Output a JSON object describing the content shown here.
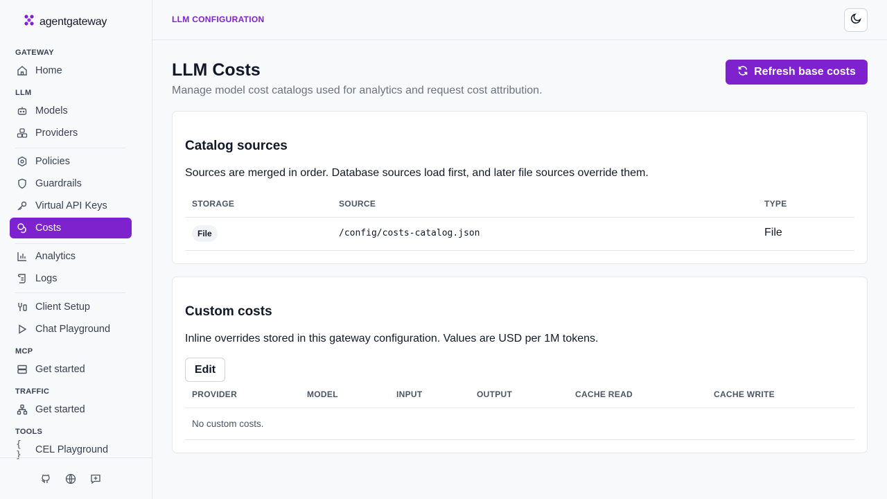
{
  "app": {
    "brand": "agentgateway"
  },
  "sidebar": {
    "sections": {
      "gateway": "GATEWAY",
      "llm": "LLM",
      "mcp": "MCP",
      "traffic": "TRAFFIC",
      "tools": "TOOLS"
    },
    "items": {
      "home": "Home",
      "models": "Models",
      "providers": "Providers",
      "policies": "Policies",
      "guardrails": "Guardrails",
      "virtual_keys": "Virtual API Keys",
      "costs": "Costs",
      "analytics": "Analytics",
      "logs": "Logs",
      "client_setup": "Client Setup",
      "chat_playground": "Chat Playground",
      "mcp_get_started": "Get started",
      "traffic_get_started": "Get started",
      "cel_playground": "CEL Playground"
    },
    "active_item": "Costs",
    "footer_icons": [
      "github-icon",
      "globe-icon",
      "feedback-icon"
    ]
  },
  "header": {
    "breadcrumb": "LLM CONFIGURATION",
    "theme_icon": "moon-icon"
  },
  "page": {
    "title": "LLM Costs",
    "subtitle": "Manage model cost catalogs used for analytics and request cost attribution.",
    "refresh_label": "Refresh base costs"
  },
  "catalog": {
    "title": "Catalog sources",
    "description": "Sources are merged in order. Database sources load first, and later file sources override them.",
    "columns": [
      "STORAGE",
      "SOURCE",
      "TYPE"
    ],
    "rows": [
      {
        "storage": "File",
        "source": "/config/costs-catalog.json",
        "type": "File"
      }
    ]
  },
  "custom": {
    "title": "Custom costs",
    "description": "Inline overrides stored in this gateway configuration. Values are USD per 1M tokens.",
    "edit_label": "Edit",
    "columns": [
      "PROVIDER",
      "MODEL",
      "INPUT",
      "OUTPUT",
      "CACHE READ",
      "CACHE WRITE"
    ],
    "empty": "No custom costs."
  },
  "colors": {
    "accent": "#7e22ce",
    "border": "#e5e7eb",
    "background": "#f8f9fb"
  }
}
